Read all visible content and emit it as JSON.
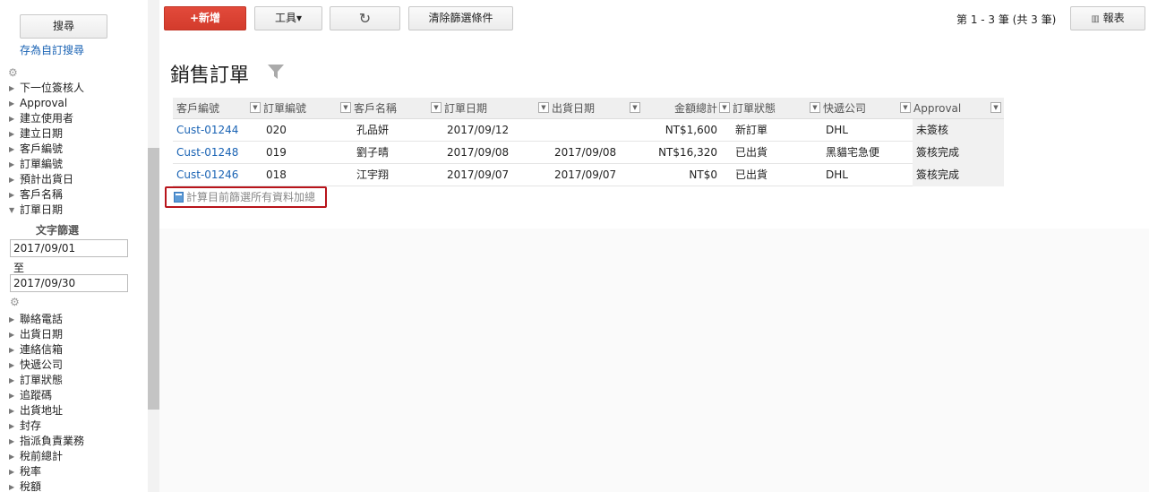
{
  "sidebar": {
    "search_button": "搜尋",
    "save_search": "存為自訂搜尋",
    "fields_top": [
      {
        "label": "下一位簽核人",
        "expanded": false
      },
      {
        "label": "Approval",
        "expanded": false
      },
      {
        "label": "建立使用者",
        "expanded": false
      },
      {
        "label": "建立日期",
        "expanded": false
      },
      {
        "label": "客戶編號",
        "expanded": false
      },
      {
        "label": "訂單編號",
        "expanded": false
      },
      {
        "label": "預計出貨日",
        "expanded": false
      },
      {
        "label": "客戶名稱",
        "expanded": false
      },
      {
        "label": "訂單日期",
        "expanded": true
      }
    ],
    "text_filter_title": "文字篩選",
    "date_from": "2017/09/01",
    "to_label": "至",
    "date_to": "2017/09/30",
    "fields_bottom": [
      {
        "label": "聯絡電話"
      },
      {
        "label": "出貨日期"
      },
      {
        "label": "連絡信箱"
      },
      {
        "label": "快遞公司"
      },
      {
        "label": "訂單狀態"
      },
      {
        "label": "追蹤碼"
      },
      {
        "label": "出貨地址"
      },
      {
        "label": "封存"
      },
      {
        "label": "指派負責業務"
      },
      {
        "label": "稅前總計"
      },
      {
        "label": "稅率"
      },
      {
        "label": "稅額"
      }
    ]
  },
  "toolbar": {
    "new_label": "+新增",
    "tools_label": "工具▾",
    "refresh_icon": "↻",
    "clear_filters_label": "清除篩選條件",
    "page_info": "第 1 - 3 筆 (共 3 筆)",
    "report_label": "報表"
  },
  "page": {
    "title": "銷售訂單"
  },
  "table": {
    "headers": [
      "客戶編號",
      "訂單編號",
      "客戶名稱",
      "訂單日期",
      "出貨日期",
      "金額總計",
      "訂單狀態",
      "快遞公司",
      "Approval"
    ],
    "rows": [
      [
        "Cust-01244",
        "020",
        "孔品妍",
        "2017/09/12",
        "",
        "NT$1,600",
        "新訂單",
        "DHL",
        "未簽核"
      ],
      [
        "Cust-01248",
        "019",
        "劉子晴",
        "2017/09/08",
        "2017/09/08",
        "NT$16,320",
        "已出貨",
        "黑貓宅急便",
        "簽核完成"
      ],
      [
        "Cust-01246",
        "018",
        "江宇翔",
        "2017/09/07",
        "2017/09/07",
        "NT$0",
        "已出貨",
        "DHL",
        "簽核完成"
      ]
    ],
    "calc_label": "計算目前篩選所有資料加總"
  },
  "colors": {
    "new_button": "#d8402f",
    "link": "#1a63b4",
    "highlight_border": "#b8141b"
  }
}
